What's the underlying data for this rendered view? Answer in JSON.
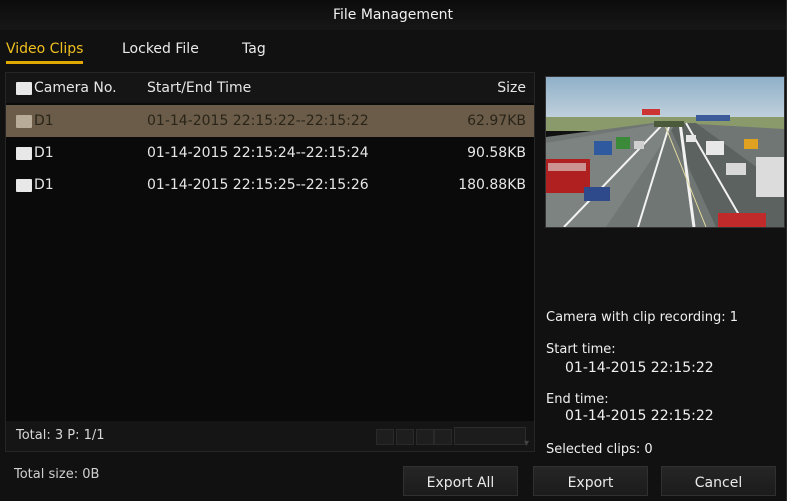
{
  "window": {
    "title": "File Management"
  },
  "tabs": [
    {
      "label": "Video Clips",
      "active": true
    },
    {
      "label": "Locked File",
      "active": false
    },
    {
      "label": "Tag",
      "active": false
    }
  ],
  "list": {
    "headers": {
      "camera": "Camera No.",
      "time": "Start/End Time",
      "size": "Size"
    },
    "rows": [
      {
        "camera": "D1",
        "time": "01-14-2015 22:15:22--22:15:22",
        "size": "62.97KB",
        "selected": true
      },
      {
        "camera": "D1",
        "time": "01-14-2015 22:15:24--22:15:24",
        "size": "90.58KB",
        "selected": false
      },
      {
        "camera": "D1",
        "time": "01-14-2015 22:15:25--22:15:26",
        "size": "180.88KB",
        "selected": false
      }
    ],
    "footer": {
      "total": "Total: 3  P: 1/1"
    }
  },
  "info": {
    "camera_line": "Camera with clip recording: 1",
    "start_label": "Start time:",
    "start_value": "01-14-2015 22:15:22",
    "end_label": "End time:",
    "end_value": "01-14-2015 22:15:22",
    "selected": "Selected clips: 0"
  },
  "bottom": {
    "total_size": "Total size: 0B",
    "export_all": "Export All",
    "export": "Export",
    "cancel": "Cancel"
  },
  "colors": {
    "accent": "#f0c020",
    "selected_row": "#6a5c48",
    "background": "#111111"
  },
  "icons": [
    "checkbox-icon",
    "first-page-icon",
    "prev-page-icon",
    "next-page-icon",
    "last-page-icon",
    "page-dropdown-icon"
  ]
}
